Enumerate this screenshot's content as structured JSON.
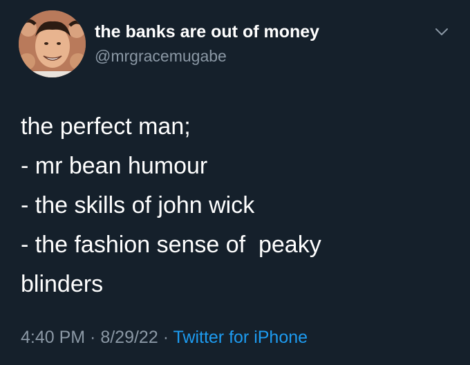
{
  "author": {
    "display_name": "the banks are out of money",
    "handle": "@mrgracemugabe"
  },
  "menu_icon": "chevron-down-icon",
  "tweet": {
    "lines": [
      "the perfect man;",
      "- mr bean humour",
      "- the skills of john wick",
      "- the fashion sense of  peaky",
      "blinders"
    ]
  },
  "meta": {
    "time": "4:40 PM",
    "separator_1": " · ",
    "date": "8/29/22",
    "separator_2": " · ",
    "source": "Twitter for iPhone"
  },
  "colors": {
    "background": "#15202b",
    "text": "#ffffff",
    "secondary": "#8b98a5",
    "link": "#1d9bf0"
  }
}
